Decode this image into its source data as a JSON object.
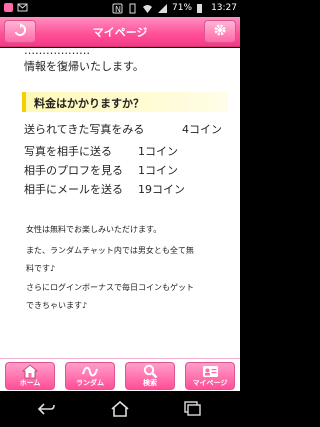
{
  "status_bar": {
    "battery": "71%",
    "time": "13:27",
    "icons": [
      "app-icon",
      "mail-icon",
      "nfc-icon",
      "vibrate-icon",
      "wifi-icon",
      "signal-icon",
      "battery-icon"
    ]
  },
  "header": {
    "title": "マイページ",
    "left_icon": "refresh-icon",
    "right_icon": "gear-icon"
  },
  "content": {
    "intro_lines": [
      "‥‥‥‥‥‥‥‥‥",
      "情報を復帰いたします。"
    ],
    "section_title": "料金はかかりますか？",
    "prices": [
      {
        "label": "送られてきた写真をみる",
        "amount": "4コイン"
      },
      {
        "label": "写真を相手に送る",
        "amount": "1コイン"
      },
      {
        "label": "相手のプロフを見る",
        "amount": "1コイン"
      },
      {
        "label": "相手にメールを送る",
        "amount": "19コイン"
      }
    ],
    "notes": [
      "女性は無料でお楽しみいただけます。",
      "また、ランダムチャット内では男女とも全て無",
      "料です♪",
      "さらにログインボーナスで毎日コインもゲット",
      "できちゃいます♪"
    ]
  },
  "tabs": [
    {
      "label": "ホーム",
      "icon": "home-icon"
    },
    {
      "label": "ランダム",
      "icon": "random-icon"
    },
    {
      "label": "検索",
      "icon": "search-icon"
    },
    {
      "label": "マイページ",
      "icon": "profile-card-icon"
    }
  ],
  "nav": [
    "back-icon",
    "home-icon",
    "recent-apps-icon"
  ],
  "colors": {
    "accent": "#ff4f98",
    "section_bar": "#f4d000"
  }
}
